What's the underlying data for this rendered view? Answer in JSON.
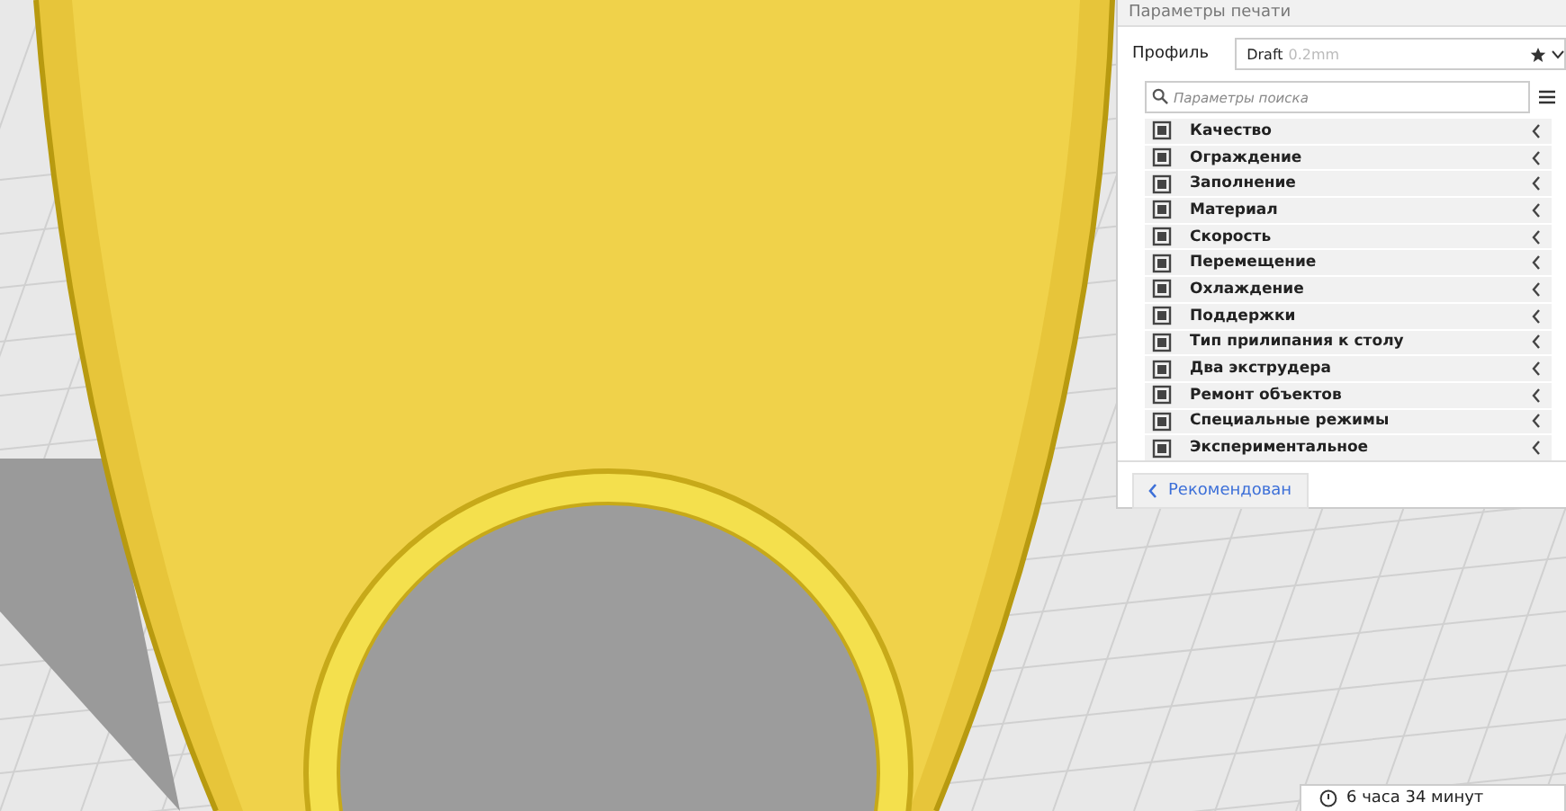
{
  "panel": {
    "title": "Параметры печати",
    "profile_label": "Профиль",
    "profile": {
      "name": "Draft",
      "detail": "0.2mm"
    },
    "search": {
      "placeholder": "Параметры поиска"
    },
    "categories": [
      {
        "label": "Качество"
      },
      {
        "label": "Ограждение"
      },
      {
        "label": "Заполнение"
      },
      {
        "label": "Материал"
      },
      {
        "label": "Скорость"
      },
      {
        "label": "Перемещение"
      },
      {
        "label": "Охлаждение"
      },
      {
        "label": "Поддержки"
      },
      {
        "label": "Тип прилипания к столу"
      },
      {
        "label": "Два экструдера"
      },
      {
        "label": "Ремонт объектов"
      },
      {
        "label": "Специальные режимы"
      },
      {
        "label": "Экспериментальное"
      }
    ],
    "recommended_button": "Рекомендован"
  },
  "estimate": {
    "time": "6 часа 34 минут"
  }
}
